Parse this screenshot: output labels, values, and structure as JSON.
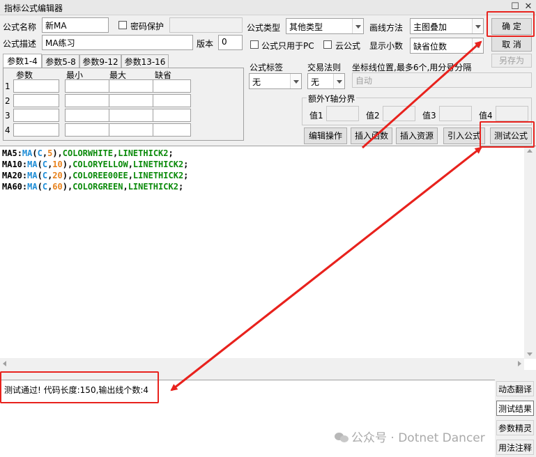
{
  "window": {
    "title": "指标公式编辑器",
    "restore_glyph": "☐",
    "close_glyph": "✕"
  },
  "form": {
    "name_label": "公式名称",
    "name_value": "新MA",
    "password_label": "密码保护",
    "desc_label": "公式描述",
    "desc_value": "MA练习",
    "version_label": "版本",
    "version_value": "0",
    "type_label": "公式类型",
    "type_value": "其他类型",
    "draw_label": "画线方法",
    "draw_value": "主图叠加",
    "pc_only_label": "公式只用于PC",
    "cloud_label": "云公式",
    "decimals_label": "显示小数",
    "decimals_value": "缺省位数",
    "tag_label": "公式标签",
    "tag_value": "无",
    "trade_label": "交易法则",
    "trade_value": "无",
    "coord_label": "坐标线位置,最多6个,用分号分隔",
    "coord_value": "自动",
    "yaxis_label": "额外Y轴分界",
    "y_values": [
      "值1",
      "值2",
      "值3",
      "值4"
    ]
  },
  "buttons": {
    "ok": "确  定",
    "cancel": "取  消",
    "save_as": "另存为",
    "edit_ops": "编辑操作",
    "insert_fn": "插入函数",
    "insert_res": "插入资源",
    "import": "引入公式",
    "test": "测试公式"
  },
  "params": {
    "tabs": [
      "参数1-4",
      "参数5-8",
      "参数9-12",
      "参数13-16"
    ],
    "headers": [
      "参数",
      "最小",
      "最大",
      "缺省"
    ],
    "rows": [
      "1",
      "2",
      "3",
      "4"
    ]
  },
  "code": {
    "lines": [
      [
        [
          "MA5",
          "c-name"
        ],
        [
          ":",
          "c-p"
        ],
        [
          "MA",
          "c-fn"
        ],
        [
          "(",
          "c-p"
        ],
        [
          "C",
          "c-fn"
        ],
        [
          ",",
          "c-p"
        ],
        [
          "5",
          "c-num"
        ],
        [
          "),",
          "c-p"
        ],
        [
          "COLORWHITE",
          "c-kw"
        ],
        [
          ",",
          "c-p"
        ],
        [
          "LINETHICK2",
          "c-kw"
        ],
        [
          ";",
          "c-p"
        ]
      ],
      [
        [
          "MA10",
          "c-name"
        ],
        [
          ":",
          "c-p"
        ],
        [
          "MA",
          "c-fn"
        ],
        [
          "(",
          "c-p"
        ],
        [
          "C",
          "c-fn"
        ],
        [
          ",",
          "c-p"
        ],
        [
          "10",
          "c-num"
        ],
        [
          "),",
          "c-p"
        ],
        [
          "COLORYELLOW",
          "c-kw"
        ],
        [
          ",",
          "c-p"
        ],
        [
          "LINETHICK2",
          "c-kw"
        ],
        [
          ";",
          "c-p"
        ]
      ],
      [
        [
          "MA20",
          "c-name"
        ],
        [
          ":",
          "c-p"
        ],
        [
          "MA",
          "c-fn"
        ],
        [
          "(",
          "c-p"
        ],
        [
          "C",
          "c-fn"
        ],
        [
          ",",
          "c-p"
        ],
        [
          "20",
          "c-num"
        ],
        [
          "),",
          "c-p"
        ],
        [
          "COLOREE00EE",
          "c-kw"
        ],
        [
          ",",
          "c-p"
        ],
        [
          "LINETHICK2",
          "c-kw"
        ],
        [
          ";",
          "c-p"
        ]
      ],
      [
        [
          "MA60",
          "c-name"
        ],
        [
          ":",
          "c-p"
        ],
        [
          "MA",
          "c-fn"
        ],
        [
          "(",
          "c-p"
        ],
        [
          "C",
          "c-fn"
        ],
        [
          ",",
          "c-p"
        ],
        [
          "60",
          "c-num"
        ],
        [
          "),",
          "c-p"
        ],
        [
          "COLORGREEN",
          "c-kw"
        ],
        [
          ",",
          "c-p"
        ],
        [
          "LINETHICK2",
          "c-kw"
        ],
        [
          ";",
          "c-p"
        ]
      ]
    ]
  },
  "result": {
    "text": "测试通过! 代码长度:150,输出线个数:4"
  },
  "side_tabs": [
    "动态翻译",
    "测试结果",
    "参数精灵",
    "用法注释"
  ],
  "watermark": "公众号 · Dotnet Dancer",
  "annotation_color": "#e8221d"
}
